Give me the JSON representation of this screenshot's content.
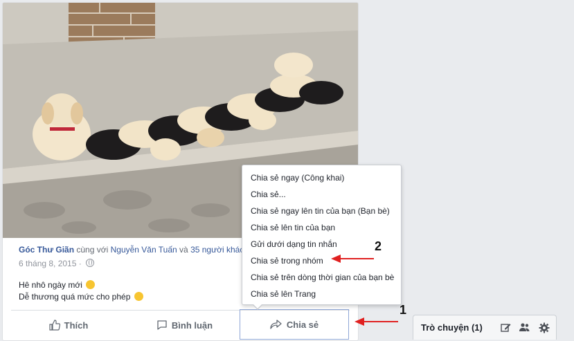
{
  "post": {
    "author": "Góc Thư Giãn",
    "with_text": "cùng với",
    "tagged_person": "Nguyễn Văn Tuấn",
    "and_text": "và",
    "others": "35 người khác",
    "date": "6 tháng 8, 2015 ·",
    "caption_line1": "Hê nhô ngày mới",
    "caption_line2": "Dễ thương quá mức cho phép"
  },
  "actions": {
    "like": "Thích",
    "comment": "Bình luận",
    "share": "Chia sẻ"
  },
  "share_menu": {
    "items": [
      "Chia sẻ ngay (Công khai)",
      "Chia sẻ...",
      "Chia sẻ ngay lên tin của bạn (Bạn bè)",
      "Chia sẻ lên tin của bạn",
      "Gửi dưới dạng tin nhắn",
      "Chia sẻ trong nhóm",
      "Chia sẻ trên dòng thời gian của bạn bè",
      "Chia sẻ lên Trang"
    ]
  },
  "callouts": {
    "one": "1",
    "two": "2"
  },
  "chat": {
    "title": "Trò chuyện (1)"
  },
  "colors": {
    "annotation_arrow": "#e02020",
    "link": "#365899",
    "share_border": "#8ea6d6"
  },
  "icons": [
    "globe-icon",
    "thumbs-up-icon",
    "comment-icon",
    "share-arrow-icon",
    "compose-icon",
    "people-icon",
    "gear-icon"
  ]
}
